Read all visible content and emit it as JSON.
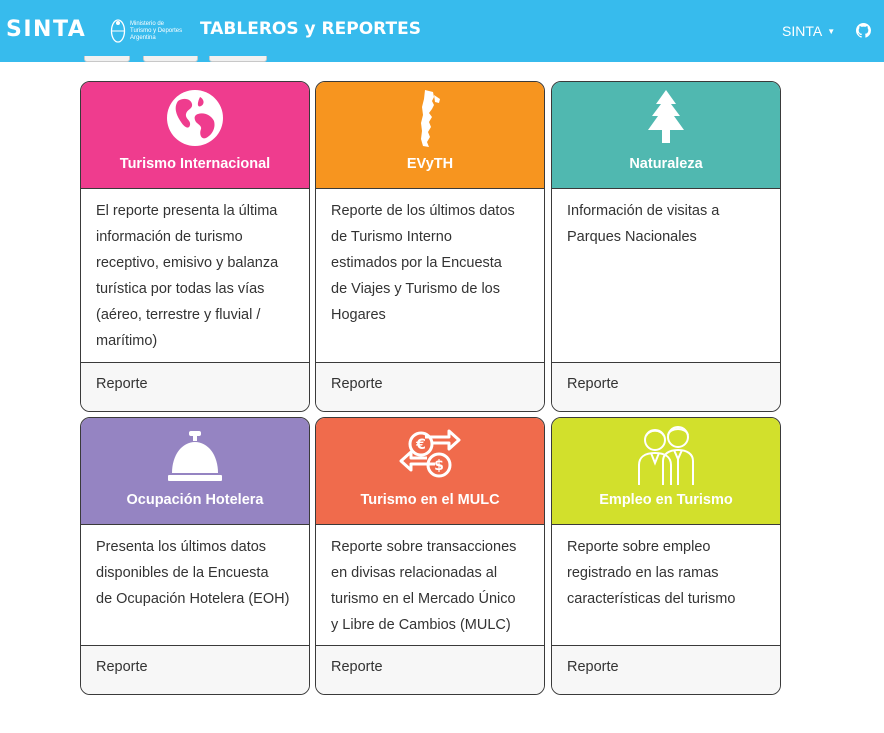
{
  "navbar": {
    "brand": "SINTA",
    "ministry_lines": [
      "Ministerio de",
      "Turismo y Deportes",
      "Argentina"
    ],
    "title": "TABLEROS y REPORTES",
    "menu_label": "SINTA"
  },
  "colors": {
    "navbar": "#37bbed",
    "turismo_internacional": "#ef3c8e",
    "evyth": "#f7951f",
    "naturaleza": "#50b8b0",
    "ocupacion_hotelera": "#9584c2",
    "mulc": "#f06b4c",
    "empleo": "#d2e02c"
  },
  "cards": [
    {
      "title": "Turismo Internacional",
      "icon": "globe-icon",
      "body": [
        "El reporte presenta la última",
        "información de turismo",
        "receptivo, emisivo y balanza",
        "turística por todas las vías",
        "(aéreo, terrestre y fluvial /",
        "marítimo)"
      ],
      "footer": "Reporte"
    },
    {
      "title": "EVyTH",
      "icon": "argentina-map-icon",
      "body": [
        "Reporte de los últimos datos",
        "de Turismo Interno",
        "estimados por la Encuesta",
        "de Viajes y Turismo de los",
        "Hogares"
      ],
      "footer": "Reporte"
    },
    {
      "title": "Naturaleza",
      "icon": "pine-tree-icon",
      "body": [
        "Información de visitas a",
        "Parques Nacionales"
      ],
      "footer": "Reporte"
    },
    {
      "title": "Ocupación Hotelera",
      "icon": "service-bell-icon",
      "body": [
        "Presenta los últimos datos",
        "disponibles de la Encuesta",
        "de Ocupación Hotelera (EOH)"
      ],
      "footer": "Reporte"
    },
    {
      "title": "Turismo en el MULC",
      "icon": "currency-exchange-icon",
      "body": [
        "Reporte sobre transacciones",
        "en divisas relacionadas al",
        "turismo en el Mercado Único",
        "y Libre de Cambios (MULC)"
      ],
      "footer": "Reporte"
    },
    {
      "title": "Empleo en Turismo",
      "icon": "workers-icon",
      "body": [
        "Reporte sobre empleo",
        "registrado en las ramas",
        "características del turismo"
      ],
      "footer": "Reporte"
    }
  ]
}
